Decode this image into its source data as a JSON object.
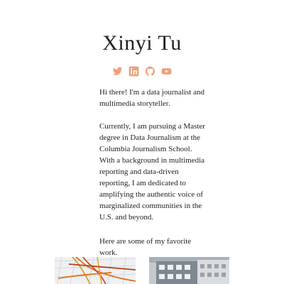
{
  "profile": {
    "name": "Xinyi Tu"
  },
  "social": [
    {
      "icon": "twitter-icon",
      "label": "Twitter"
    },
    {
      "icon": "linkedin-icon",
      "label": "LinkedIn"
    },
    {
      "icon": "github-icon",
      "label": "GitHub"
    },
    {
      "icon": "youtube-icon",
      "label": "YouTube"
    }
  ],
  "accent_color": "#f0a07a",
  "bio": {
    "intro": "Hi there! I'm a data journalist and multimedia storyteller.",
    "background": "Currently, I am pursuing a Master degree in Data Journalism at the Columbia Journalism School. With a background in multimedia reporting and data-driven reporting, I am dedicated to amplifying the authentic voice of marginalized communities in the U.S. and beyond.",
    "favorites": "Here are some of my favorite work."
  },
  "works": [
    {
      "thumbnail": "map-thumbnail"
    },
    {
      "thumbnail": "building-photo-thumbnail"
    }
  ]
}
